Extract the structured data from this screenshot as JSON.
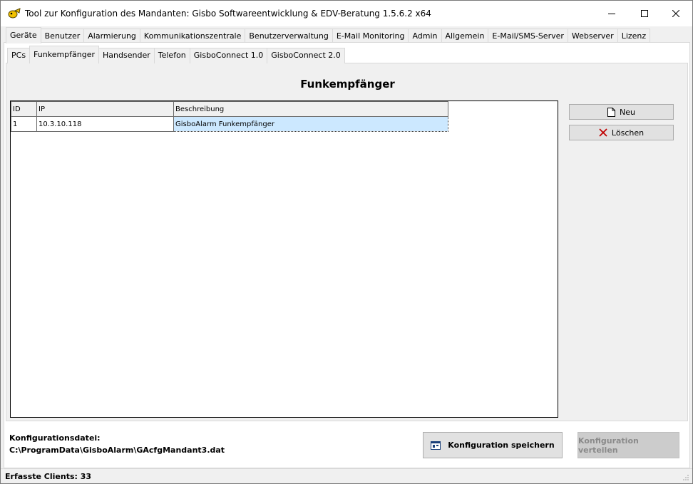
{
  "window": {
    "title": "Tool zur Konfiguration des Mandanten: Gisbo Softwareentwicklung & EDV-Beratung 1.5.6.2 x64"
  },
  "main_tabs": [
    "Geräte",
    "Benutzer",
    "Alarmierung",
    "Kommunikationszentrale",
    "Benutzerverwaltung",
    "E-Mail Monitoring",
    "Admin",
    "Allgemein",
    "E-Mail/SMS-Server",
    "Webserver",
    "Lizenz"
  ],
  "main_tab_active": "Geräte",
  "sub_tabs": [
    "PCs",
    "Funkempfänger",
    "Handsender",
    "Telefon",
    "GisboConnect 1.0",
    "GisboConnect 2.0"
  ],
  "sub_tab_active": "Funkempfänger",
  "panel": {
    "heading": "Funkempfänger"
  },
  "grid": {
    "columns": [
      "ID",
      "IP",
      "Beschreibung"
    ],
    "rows": [
      [
        "1",
        "10.3.10.118",
        "GisboAlarm Funkempfänger"
      ]
    ]
  },
  "buttons": {
    "new_label": "Neu",
    "delete_label": "Löschen",
    "save_label": "Konfiguration speichern",
    "distribute_label": "Konfiguration verteilen"
  },
  "footer": {
    "config_label": "Konfigurationsdatei:",
    "config_path": "C:\\ProgramData\\GisboAlarm\\GAcfgMandant3.dat"
  },
  "status": {
    "text": "Erfasste Clients: 33"
  },
  "icons": {
    "app": "app-icon",
    "minimize": "minimize-icon",
    "maximize": "maximize-icon",
    "close": "close-icon",
    "new": "new-document-icon",
    "delete": "delete-x-icon",
    "save": "save-config-icon"
  },
  "colors": {
    "selection": "#cce8ff",
    "delete_icon": "#c00000",
    "disabled_text": "#8a8a8a"
  }
}
